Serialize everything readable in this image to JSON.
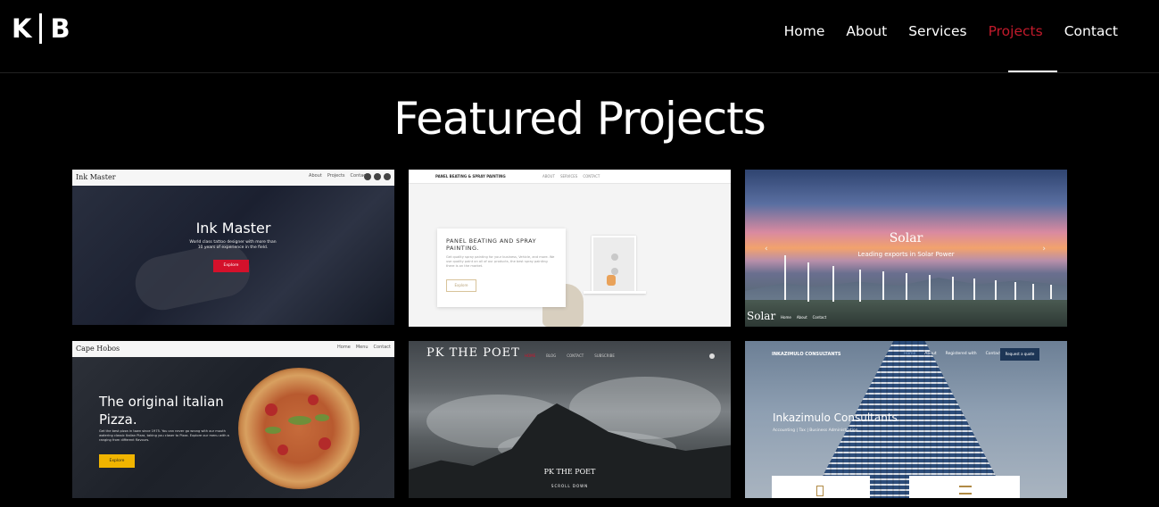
{
  "logo": {
    "left": "K",
    "right": "B"
  },
  "nav": {
    "items": [
      {
        "label": "Home"
      },
      {
        "label": "About"
      },
      {
        "label": "Services"
      },
      {
        "label": "Projects"
      },
      {
        "label": "Contact"
      }
    ],
    "active": "Projects"
  },
  "page": {
    "title": "Featured Projects"
  },
  "projects": [
    {
      "brand": "Ink Master",
      "nav": [
        "About",
        "Projects",
        "Contact"
      ],
      "heading": "Ink Master",
      "subtitle": "World class tattoo designer with more than 10 years of experience in the field.",
      "button": "Explore"
    },
    {
      "brand": "PANEL BEATING & SPRAY PAINTING",
      "nav": [
        "ABOUT",
        "SERVICES",
        "CONTACT"
      ],
      "heading": "PANEL BEATING AND SPRAY PAINTING.",
      "text": "Get quality spray painting for your business, Vehicle, and more. We use quality paint on all of our products, the best spray painting there is on the market.",
      "button": "Explore"
    },
    {
      "heading": "Solar",
      "subtitle": "Leading exports in Solar Power",
      "brand": "Solar",
      "nav": [
        "Home",
        "About",
        "Contact"
      ]
    },
    {
      "brand": "Cape Hobos",
      "nav": [
        "Home",
        "Menu",
        "Contact"
      ],
      "heading": "The original italian Pizza.",
      "text": "Get the best pizza in town since 1975. You can never go wrong with our mouth watering classic Italian Pizza, taking you closer to Pizza. Explore our menu with a ranging from different flavours.",
      "button": "Explore"
    },
    {
      "brand": "PK THE POET",
      "nav": [
        "HOME",
        "BLOG",
        "CONTACT",
        "SUBSCRIBE"
      ],
      "heading": "PK THE POET",
      "scroll": "SCROLL DOWN"
    },
    {
      "brand": "INKAZIMULO CONSULTANTS",
      "nav": [
        "Home",
        "About",
        "Registered with",
        "Contact"
      ],
      "quote_button": "Request a quote",
      "heading": "Inkazimulo Consultants",
      "subtitle": "Accounting | Tax | Business Administration"
    }
  ],
  "colors": {
    "accent": "#c11a2b",
    "background": "#000000"
  }
}
